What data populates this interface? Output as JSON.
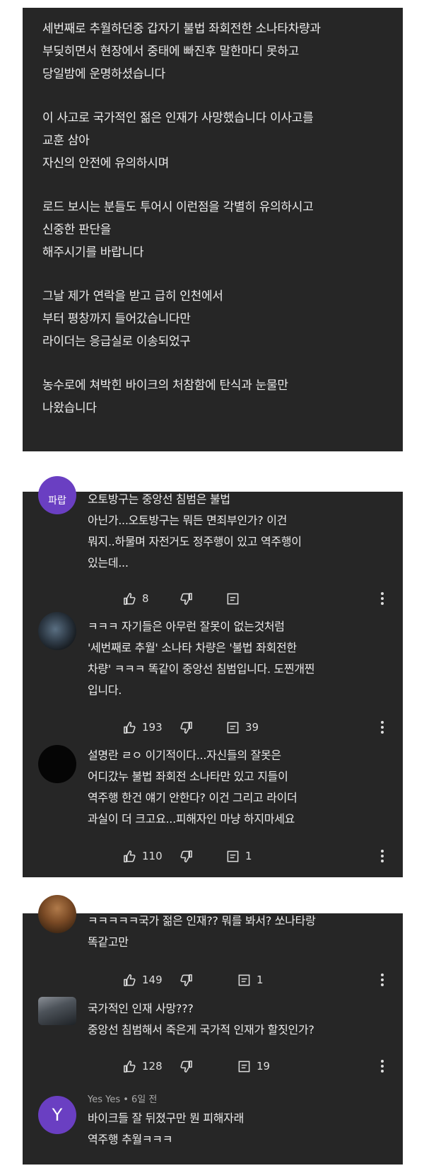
{
  "post": {
    "paragraphs": [
      [
        "세번째로 추월하던중 갑자기 불법 좌회전한 소나타차량과",
        "부딪히면서 현장에서 중태에 빠진후 말한마디 못하고",
        "당일밤에 운명하셨습니다"
      ],
      [
        "이 사고로 국가적인 젊은 인재가 사망했습니다 이사고를",
        "교훈 삼아",
        "자신의 안전에 유의하시며"
      ],
      [
        "로드 보시는 분들도 투어시 이런점을 각별히 유의하시고",
        "신중한 판단을",
        "해주시기를 바랍니다"
      ],
      [
        "그날 제가 연락을 받고 급히 인천에서",
        "부터 평창까지 들어갔습니다만",
        "라이더는 응급실로 이송되었구"
      ],
      [
        "농수로에 쳐박힌 바이크의 처참함에 탄식과 눈물만",
        "나왔습니다"
      ]
    ]
  },
  "comments_a": [
    {
      "avatar_text": "파랍",
      "lines": [
        "오토방구는 중앙선 침범은 불법",
        "아닌가...오토방구는 뭐든 면죄부인가? 이건",
        "뭐지..하물며 자전거도 정주행이 있고 역주행이",
        "있는데..."
      ],
      "likes": "8",
      "replies": ""
    },
    {
      "avatar_text": "",
      "lines": [
        "ㅋㅋㅋ 자기들은 아무런 잘못이 없는것처럼",
        "'세번째로 추월' 소나타 차량은 '불법 좌회전한",
        "차량' ㅋㅋㅋ 똑같이 중앙선 침범입니다. 도찐개찐",
        "입니다."
      ],
      "likes": "193",
      "replies": "39"
    },
    {
      "avatar_text": "",
      "lines": [
        "설명란 ㄹㅇ 이기적이다...자신들의 잘못은",
        "어디갔누 불법 좌회전 소나타만 있고 지들이",
        "역주행 한건 얘기 안한다? 이건 그리고 라이더",
        "과실이 더 크고요...피해자인 마냥 하지마세요"
      ],
      "likes": "110",
      "replies": "1"
    }
  ],
  "comments_b": [
    {
      "author": "",
      "lines": [
        "ㅋㅋㅋㅋㅋ국가 젊은 인재?? 뭐를 봐서? 쏘나타랑",
        "똑같고만"
      ],
      "likes": "149",
      "replies": "1"
    },
    {
      "author": "",
      "lines": [
        "국가적인 인재 사망???",
        "중앙선 침범해서 죽은게 국가적 인재가 할짓인가?"
      ],
      "likes": "128",
      "replies": "19"
    },
    {
      "author": "Yes Yes • 6일 전",
      "avatar_letter": "Y",
      "lines": [
        "바이크들 잘 뒤졌구만 뭔 피해자래",
        "역주행 추월ㅋㅋㅋ"
      ],
      "likes": "",
      "replies": ""
    }
  ],
  "colors": {
    "panel": "#262626",
    "avatar_purple": "#6a3fc2",
    "text": "#ececec"
  }
}
